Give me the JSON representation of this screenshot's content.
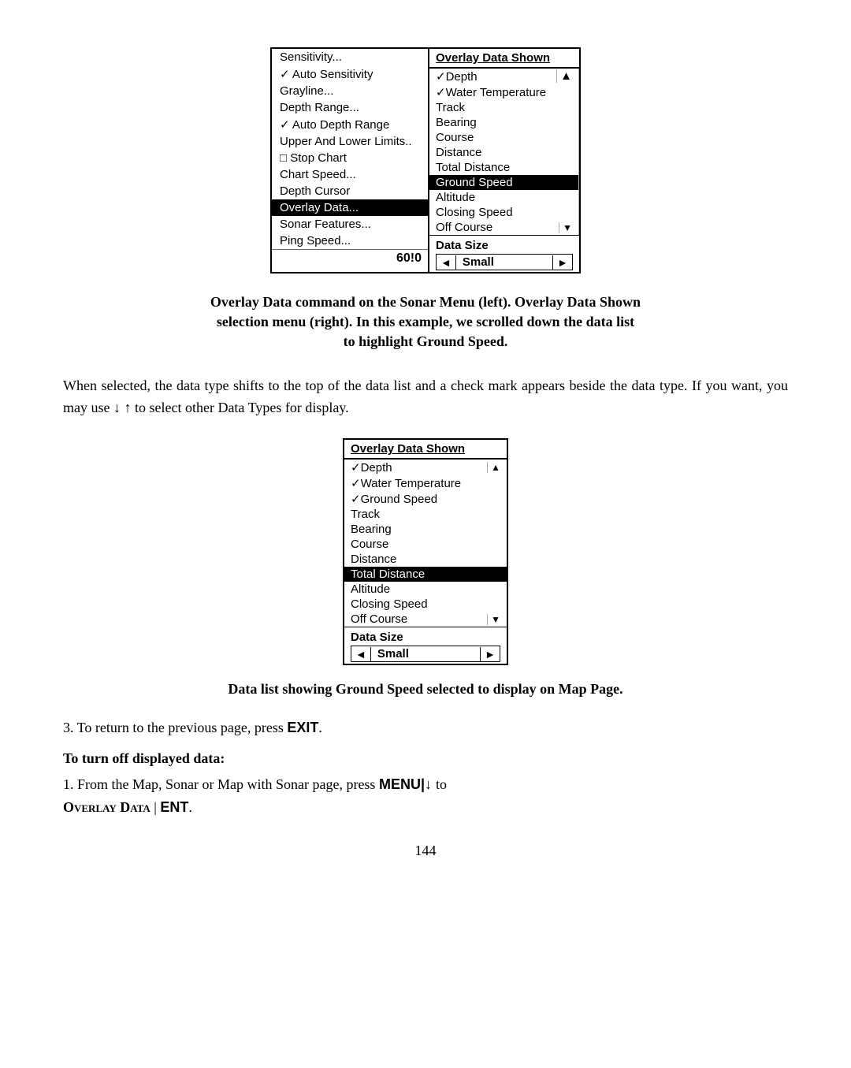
{
  "screenshot1": {
    "left_menu": {
      "items": [
        {
          "label": "Sensitivity...",
          "highlighted": false,
          "checkbox": null
        },
        {
          "label": "✓ Auto Sensitivity",
          "highlighted": false,
          "checkbox": "checked"
        },
        {
          "label": "Grayline...",
          "highlighted": false,
          "checkbox": null
        },
        {
          "label": "Depth Range...",
          "highlighted": false,
          "checkbox": null
        },
        {
          "label": "✓ Auto Depth Range",
          "highlighted": false,
          "checkbox": "checked"
        },
        {
          "label": "Upper And Lower Limits..",
          "highlighted": false,
          "checkbox": null
        },
        {
          "label": "□ Stop Chart",
          "highlighted": false,
          "checkbox": "unchecked"
        },
        {
          "label": "Chart Speed...",
          "highlighted": false,
          "checkbox": null
        },
        {
          "label": "Depth Cursor",
          "highlighted": false,
          "checkbox": null
        },
        {
          "label": "Overlay Data...",
          "highlighted": true,
          "checkbox": null
        },
        {
          "label": "Sonar Features...",
          "highlighted": false,
          "checkbox": null
        },
        {
          "label": "Ping Speed...",
          "highlighted": false,
          "checkbox": null
        }
      ],
      "footer_value": "60!0"
    },
    "right_panel": {
      "header": "Overlay Data Shown",
      "items": [
        {
          "label": "✓Depth",
          "highlighted": false
        },
        {
          "label": "✓Water Temperature",
          "highlighted": false
        },
        {
          "label": "Track",
          "highlighted": false
        },
        {
          "label": "Bearing",
          "highlighted": false
        },
        {
          "label": "Course",
          "highlighted": false
        },
        {
          "label": "Distance",
          "highlighted": false
        },
        {
          "label": "Total Distance",
          "highlighted": false
        },
        {
          "label": "Ground Speed",
          "highlighted": true
        },
        {
          "label": "Altitude",
          "highlighted": false
        },
        {
          "label": "Closing Speed",
          "highlighted": false
        },
        {
          "label": "Off Course",
          "highlighted": false
        }
      ],
      "data_size_label": "Data Size",
      "data_size_value": "Small",
      "arrow_left": "◄",
      "arrow_right": "►"
    }
  },
  "caption1_line1": "Overlay Data command on the Sonar Menu (left). Overlay Data Shown",
  "caption1_line2": "selection menu (right). In this example, we scrolled down the data list",
  "caption1_line3": "to highlight Ground Speed.",
  "body_text1": "When selected, the data type shifts to the top of the data list and a check mark appears beside the data type. If you want, you may use ↓ ↑ to select other Data Types for display.",
  "screenshot2": {
    "header": "Overlay Data Shown",
    "items": [
      {
        "label": "✓Depth",
        "highlighted": false
      },
      {
        "label": "✓Water Temperature",
        "highlighted": false
      },
      {
        "label": "✓Ground Speed",
        "highlighted": false
      },
      {
        "label": "Track",
        "highlighted": false
      },
      {
        "label": "Bearing",
        "highlighted": false
      },
      {
        "label": "Course",
        "highlighted": false
      },
      {
        "label": "Distance",
        "highlighted": false
      },
      {
        "label": "Total Distance",
        "highlighted": true
      },
      {
        "label": "Altitude",
        "highlighted": false
      },
      {
        "label": "Closing Speed",
        "highlighted": false
      },
      {
        "label": "Off Course",
        "highlighted": false
      }
    ],
    "data_size_label": "Data Size",
    "data_size_value": "Small",
    "arrow_left": "◄",
    "arrow_right": "►"
  },
  "caption2": "Data list showing Ground Speed selected to display on Map Page.",
  "step3_text": "3. To return to the previous page, press",
  "step3_key": "EXIT",
  "step4_heading": "To turn off displayed data:",
  "step4_text1": "1. From the Map, Sonar or Map with Sonar page, press",
  "step4_key1": "MENU↓",
  "step4_text2": "to",
  "step4_key2": "OVERLAY DATA",
  "step4_sep": "|",
  "step4_key3": "ENT",
  "page_number": "144"
}
